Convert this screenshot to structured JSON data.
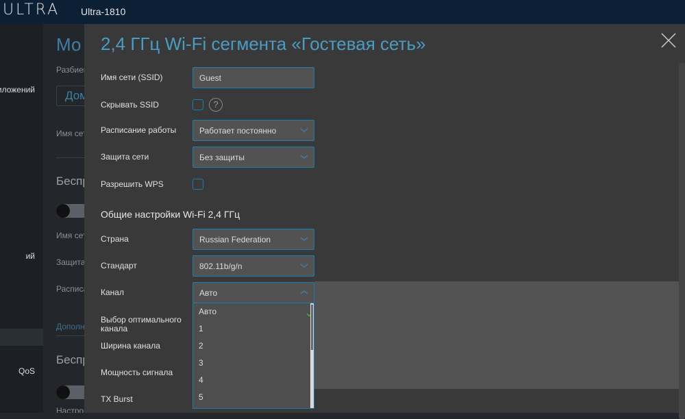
{
  "header": {
    "logo": "ULTRA",
    "model": "Ultra-1810"
  },
  "sidebar": {
    "items": [
      "иложений",
      "ий",
      "QoS"
    ]
  },
  "background_page": {
    "title": "Мо",
    "subtitle": "Разбиен",
    "tab_button": "Дом",
    "label1": "Имя сет",
    "section1": "Беспр",
    "label2": "Имя сет",
    "label3": "Защита",
    "label4": "Расписа",
    "link": "Дополн",
    "section2": "Беспр",
    "label5": "Настрой"
  },
  "modal": {
    "title": "2,4 ГГц Wi-Fi сегмента «Гостевая сеть»",
    "ssid_label": "Имя сети (SSID)",
    "ssid_value": "Guest",
    "hide_ssid_label": "Скрывать SSID",
    "help": "?",
    "schedule_label": "Расписание работы",
    "schedule_value": "Работает постоянно",
    "security_label": "Защита сети",
    "security_value": "Без защиты",
    "wps_label": "Разрешить WPS",
    "general_heading": "Общие настройки Wi-Fi 2,4 ГГц",
    "country_label": "Страна",
    "country_value": "Russian Federation",
    "standard_label": "Стандарт",
    "standard_value": "802.11b/g/n",
    "channel_label": "Канал",
    "channel_value": "Авто",
    "optimal_label": "Выбор оптимального канала",
    "width_label": "Ширина канала",
    "power_label": "Мощность сигнала",
    "txburst_label": "TX Burst",
    "channel_options": [
      "Авто",
      "1",
      "2",
      "3",
      "4",
      "5"
    ],
    "selected_option": "Авто"
  },
  "colors": {
    "accent": "#4a9cc4",
    "border": "#1a7fb0",
    "check": "#3fae5a",
    "header": "#0b2035"
  }
}
